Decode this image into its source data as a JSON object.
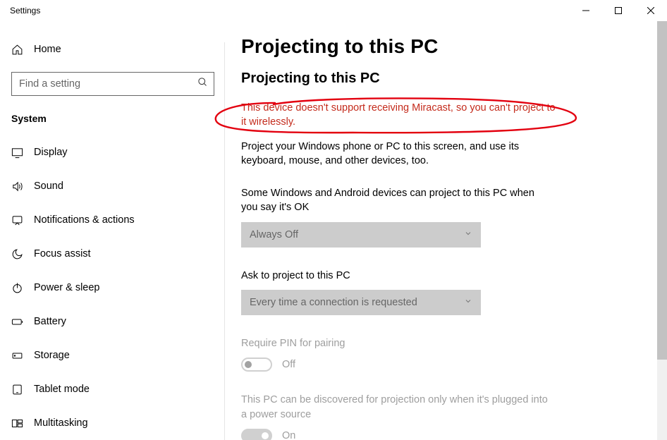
{
  "window": {
    "title": "Settings"
  },
  "sidebar": {
    "home": "Home",
    "search_placeholder": "Find a setting",
    "section": "System",
    "items": [
      {
        "label": "Display"
      },
      {
        "label": "Sound"
      },
      {
        "label": "Notifications & actions"
      },
      {
        "label": "Focus assist"
      },
      {
        "label": "Power & sleep"
      },
      {
        "label": "Battery"
      },
      {
        "label": "Storage"
      },
      {
        "label": "Tablet mode"
      },
      {
        "label": "Multitasking"
      }
    ]
  },
  "main": {
    "page_title": "Projecting to this PC",
    "sub_title": "Projecting to this PC",
    "warning": "This device doesn't support receiving Miracast, so you can't project to it wirelessly.",
    "description": "Project your Windows phone or PC to this screen, and use its keyboard, mouse, and other devices, too.",
    "field1": {
      "label": "Some Windows and Android devices can project to this PC when you say it's OK",
      "value": "Always Off"
    },
    "field2": {
      "label": "Ask to project to this PC",
      "value": "Every time a connection is requested"
    },
    "field3": {
      "label": "Require PIN for pairing",
      "state": "Off"
    },
    "field4": {
      "label": "This PC can be discovered for projection only when it's plugged into a power source",
      "state": "On"
    }
  }
}
